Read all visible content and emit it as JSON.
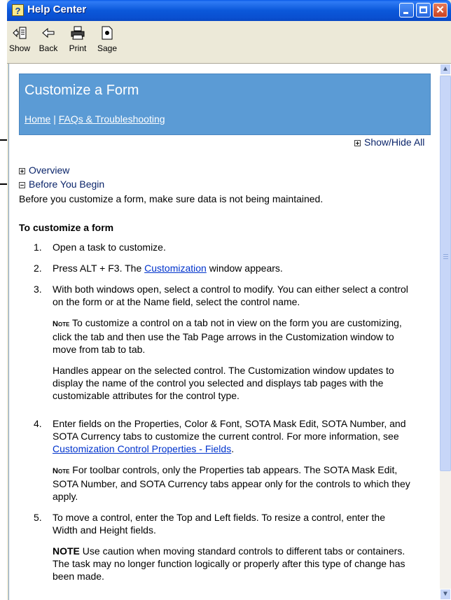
{
  "window": {
    "title": "Help Center",
    "title_icon": "help-book-icon"
  },
  "toolbar": {
    "show_label": "Show",
    "back_label": "Back",
    "print_label": "Print",
    "sage_label": "Sage"
  },
  "banner": {
    "title": "Customize a Form",
    "home_link": "Home",
    "separator": "|",
    "faq_link": "FAQs & Troubleshooting"
  },
  "showhide_label": "Show/Hide All",
  "sections": {
    "overview": "Overview",
    "before_you_begin": "Before You Begin",
    "intro": "Before you customize a form, make sure data is not being maintained."
  },
  "procedure": {
    "heading": "To customize a form",
    "step1": {
      "num": "1.",
      "text": "Open a task to customize."
    },
    "step2": {
      "num": "2.",
      "before": "Press ALT + F3. The ",
      "link": "Customization",
      "after": " window appears."
    },
    "step3": {
      "num": "3.",
      "text": "With both windows open, select a control to modify. You can either select a control on the form or at the Name field, select the control name.",
      "note_label": "Note",
      "note": " To customize a control on a tab not in view on the form you are customizing, click the tab and then use the Tab Page arrows in the Customization window to move from tab to tab.",
      "handles": "Handles appear on the selected control. The Customization window updates to display the name of the control you selected and displays tab pages with the customizable attributes for the control type."
    },
    "step4": {
      "num": "4.",
      "text": "Enter fields on the Properties, Color & Font, SOTA Mask Edit, SOTA Number, and SOTA Currency tabs to customize the current control. For more information, see ",
      "link": "Customization Control Properties - Fields",
      "after": ".",
      "note_label": "Note",
      "note": " For toolbar controls, only the Properties tab appears. The SOTA Mask Edit, SOTA Number, and SOTA Currency tabs appear only for the controls to which they apply."
    },
    "step5": {
      "num": "5.",
      "text": "To move a control, enter the Top and Left fields. To resize a control, enter the Width and Height fields.",
      "note_label": "NOTE",
      "note": " Use caution when moving standard controls to different tabs or containers. The task may no longer function logically or properly after this type of change has been made."
    }
  }
}
